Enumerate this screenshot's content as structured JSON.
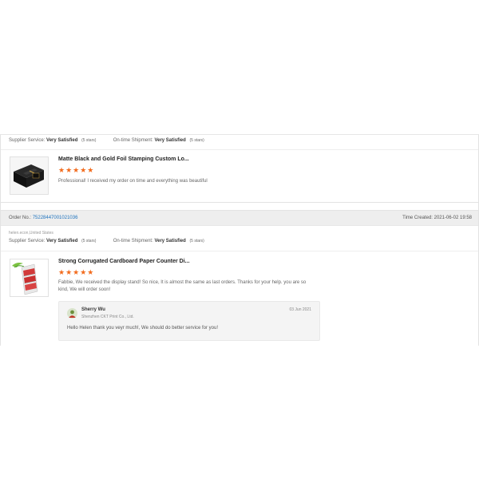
{
  "review1": {
    "supplier_service_label": "Supplier Service:",
    "supplier_service_value": "Very Satisfied",
    "supplier_service_stars": "(5 stars)",
    "shipment_label": "On-time Shipment:",
    "shipment_value": "Very Satisfied",
    "shipment_stars": "(5 stars)",
    "product_title": "Matte Black and Gold Foil Stamping Custom Lo...",
    "rating_stars": "★★★★★",
    "comment": "Professional! I received my order on time and everything was beautiful"
  },
  "order2": {
    "order_no_label": "Order No.:",
    "order_no": "75228447001021036",
    "time_label": "Time Created:",
    "time_value": "2021-06-02 19:58",
    "buyer": "helen.econ,United States",
    "supplier_service_label": "Supplier Service:",
    "supplier_service_value": "Very Satisfied",
    "supplier_service_stars": "(5 stars)",
    "shipment_label": "On-time Shipment:",
    "shipment_value": "Very Satisfied",
    "shipment_stars": "(5 stars)",
    "product_title": "Strong Corrugated Cardboard Paper Counter Di...",
    "rating_stars": "★★★★★",
    "comment": "Fabbie, We received the display stand! So nice, It is almost the same as last orders. Thanks for your help. you are so kind, We will order soon!",
    "reply": {
      "name": "Sherry Wu",
      "company": "Shenzhen CKT Print Co., Ltd.",
      "date": "03 Jun 2021",
      "text": "Hello Helen thank you veyr much!, We should do better service for you!"
    }
  },
  "colors": {
    "accent_link": "#1e73be",
    "star": "#f26b1d",
    "bar_bg": "#eeeeee"
  },
  "icons": {
    "product1": "black-gift-box-thumbnail",
    "product2": "cardboard-display-stand-thumbnail",
    "avatar": "user-avatar-icon"
  }
}
